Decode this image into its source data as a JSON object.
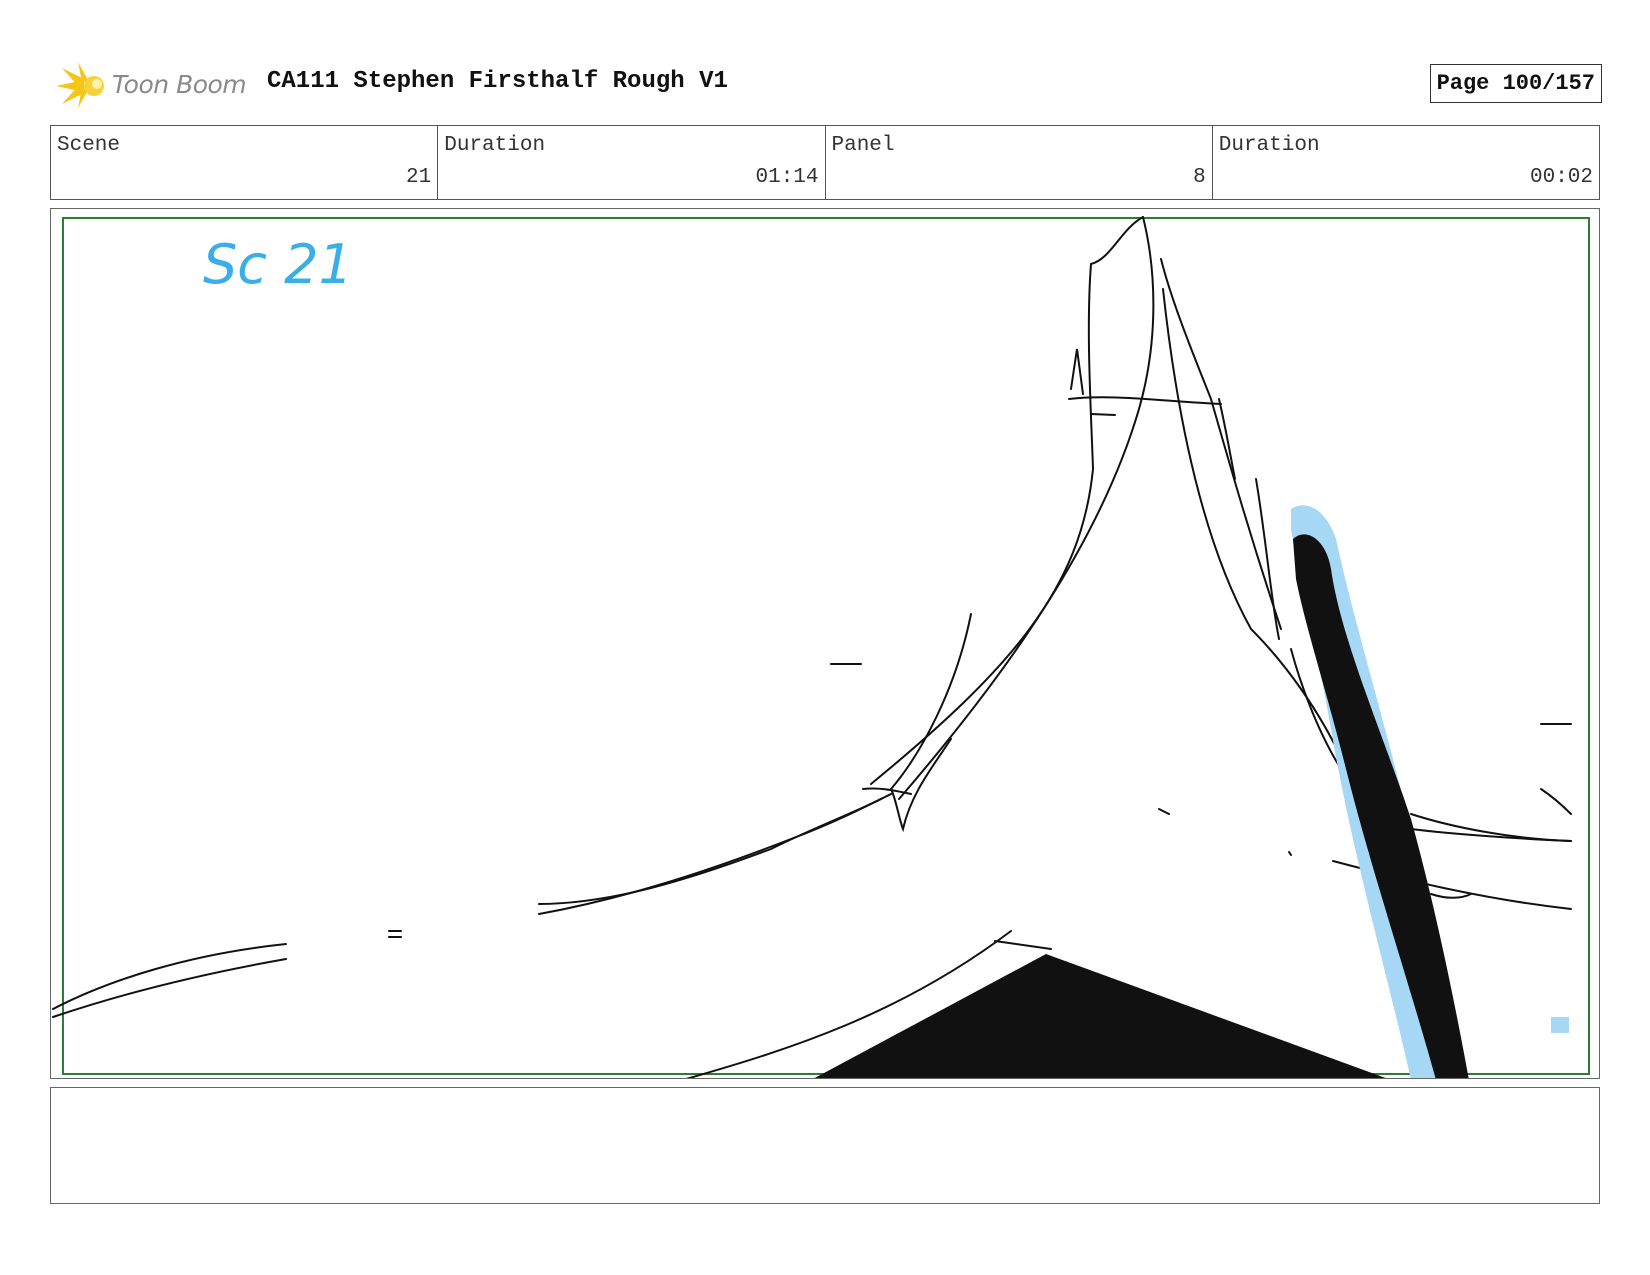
{
  "header": {
    "logo_text": "Toon Boom",
    "title": "CA111 Stephen Firsthalf Rough V1",
    "page": "Page 100/157"
  },
  "info": {
    "scene_label": "Scene",
    "scene_value": "21",
    "scene_duration_label": "Duration",
    "scene_duration_value": "01:14",
    "panel_label": "Panel",
    "panel_value": "8",
    "panel_duration_label": "Duration",
    "panel_duration_value": "00:02"
  },
  "sketch": {
    "annotation": "Sc 21",
    "annotation_color": "#3aaee8",
    "highlight_color": "#a6d8f5",
    "frame_color": "#2e7d32",
    "ink_color": "#111111"
  },
  "colors": {
    "logo_star": "#f5c518",
    "logo_text": "#8a8a8a"
  }
}
